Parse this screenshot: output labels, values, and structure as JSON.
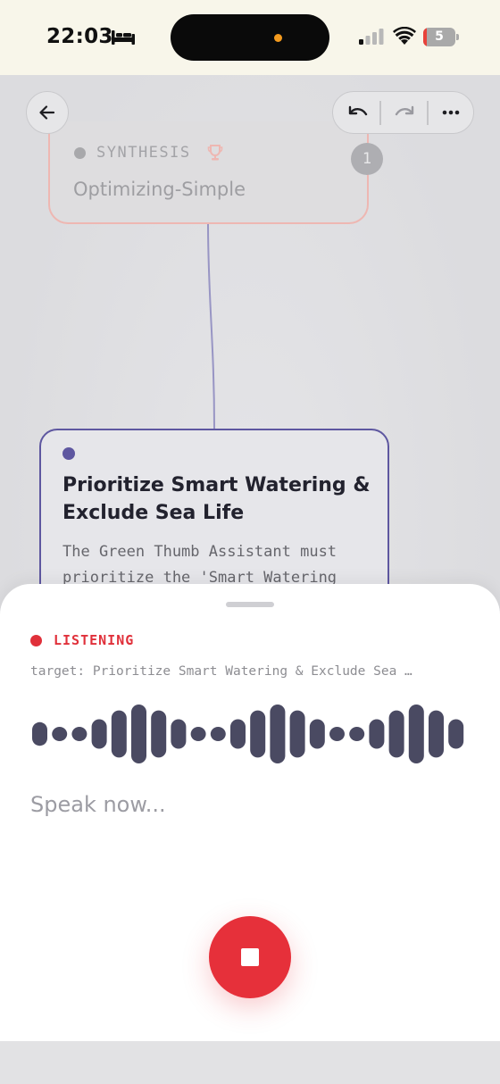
{
  "status_bar": {
    "time": "22:03",
    "battery_level": "5"
  },
  "canvas": {
    "synthesis_node": {
      "label": "SYNTHESIS",
      "title": "Optimizing-Simple",
      "badge": "1"
    },
    "selected_node": {
      "title": "Prioritize Smart Watering & Exclude Sea Life",
      "description": "The Green Thumb Assistant must prioritize the 'Smart Watering"
    }
  },
  "voice_sheet": {
    "status": "LISTENING",
    "target": "target: Prioritize Smart Watering & Exclude Sea …",
    "prompt": "Speak now...",
    "waveform_levels": [
      0.4,
      0.15,
      0.15,
      0.5,
      0.8,
      1.0,
      0.8,
      0.5,
      0.15,
      0.15,
      0.5,
      0.8,
      1.0,
      0.8,
      0.5,
      0.15,
      0.15,
      0.5,
      0.8,
      1.0,
      0.8,
      0.5
    ]
  },
  "colors": {
    "accent": "#5e57a0",
    "recording": "#e6303a",
    "waveform": "#4a4a62",
    "synthesis_border": "#eeb7b2"
  },
  "icons": [
    "bed-icon",
    "signal-icon",
    "wifi-icon",
    "battery-icon",
    "back-arrow-icon",
    "undo-icon",
    "redo-icon",
    "more-icon",
    "trophy-icon",
    "stop-icon"
  ]
}
